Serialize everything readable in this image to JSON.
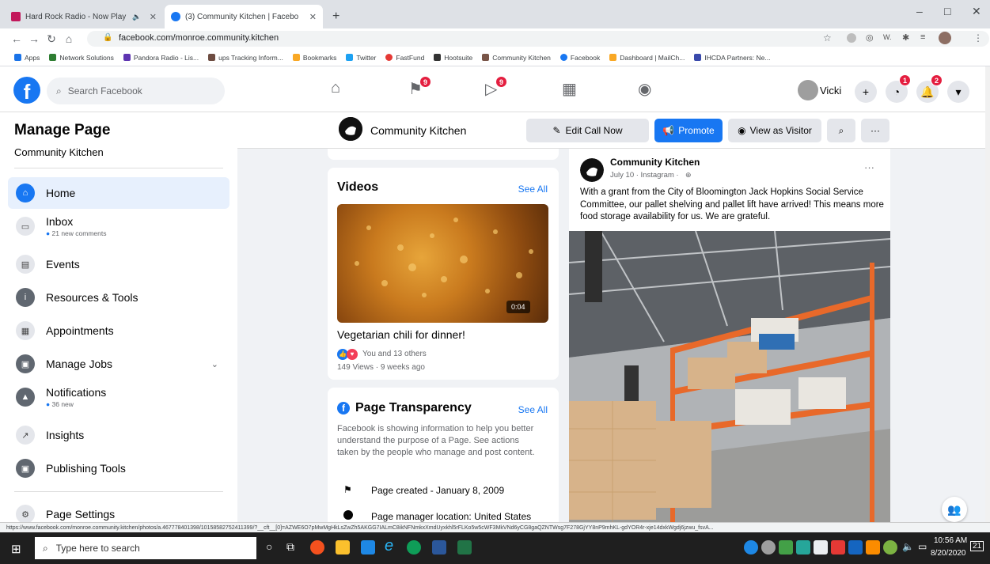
{
  "browser": {
    "tabs": [
      {
        "title": "Hard Rock Radio - Now Play",
        "favicon_color": "#c2185b"
      },
      {
        "title": "(3) Community Kitchen | Facebo",
        "favicon_color": "#1877f2"
      }
    ],
    "url": "facebook.com/monroe.community.kitchen",
    "bookmarks": [
      {
        "label": "Apps",
        "color": "#1a73e8"
      },
      {
        "label": "Network Solutions",
        "color": "#2e7d32"
      },
      {
        "label": "Pandora Radio - Lis...",
        "color": "#5e35b1"
      },
      {
        "label": "ups Tracking Inform...",
        "color": "#6d4c41"
      },
      {
        "label": "Bookmarks",
        "color": "#f9a825"
      },
      {
        "label": "Twitter",
        "color": "#1da1f2"
      },
      {
        "label": "FastFund",
        "color": "#e53935"
      },
      {
        "label": "Hootsuite",
        "color": "#333333"
      },
      {
        "label": "Community Kitchen",
        "color": "#795548"
      },
      {
        "label": "Facebook",
        "color": "#1877f2"
      },
      {
        "label": "Dashboard | MailCh...",
        "color": "#f9a825"
      },
      {
        "label": "IHCDA Partners: Ne...",
        "color": "#3949ab"
      }
    ],
    "status_url": "https://www.facebook.com/monroe.community.kitchen/photos/a.467778401398/10158582752411399/?__cft__[0]=AZWE6O7pMwMgHkLsZwZh5AKGG7IALmC8ikNFNmkxXmdUyxkhl5rFLKo5w5cWF3MkVNd6yCG8gaQZNTWsg7F278GjYY8nP9mhKL-gdYOR4r-xje14dxkWgdj6jzwu_fsvA..."
  },
  "fb": {
    "search_placeholder": "Search Facebook",
    "nav_badges": {
      "flag": "9",
      "video": "9",
      "messenger": "1",
      "notifications": "2"
    },
    "user_name": "Vicki"
  },
  "sidebar": {
    "title": "Manage Page",
    "subtitle": "Community Kitchen",
    "items": [
      {
        "label": "Home",
        "sub": ""
      },
      {
        "label": "Inbox",
        "sub": "21 new comments"
      },
      {
        "label": "Events",
        "sub": ""
      },
      {
        "label": "Resources & Tools",
        "sub": ""
      },
      {
        "label": "Appointments",
        "sub": ""
      },
      {
        "label": "Manage Jobs",
        "sub": ""
      },
      {
        "label": "Notifications",
        "sub": "36 new"
      },
      {
        "label": "Insights",
        "sub": ""
      },
      {
        "label": "Publishing Tools",
        "sub": ""
      },
      {
        "label": "Page Settings",
        "sub": ""
      }
    ]
  },
  "page_bar": {
    "page_name": "Community Kitchen",
    "edit_call": "Edit Call Now",
    "promote": "Promote",
    "view_as": "View as Visitor",
    "more": "···"
  },
  "videos": {
    "heading": "Videos",
    "see_all": "See All",
    "duration": "0:04",
    "title": "Vegetarian chili for dinner!",
    "reactions": "You and 13 others",
    "meta": "149 Views · 9 weeks ago"
  },
  "transparency": {
    "heading": "Page Transparency",
    "see_all": "See All",
    "body": "Facebook is showing information to help you better understand the purpose of a Page. See actions taken by the people who manage and post content.",
    "created": "Page created - January 8, 2009",
    "location": "Page manager location: United States"
  },
  "post": {
    "author": "Community Kitchen",
    "meta": "July 10 · Instagram ·",
    "more": "···",
    "text": "With a grant from the City of Bloomington Jack Hopkins Social Service Committee, our pallet shelving and pallet lift have arrived! This means more food storage availability for us. We are grateful."
  },
  "taskbar": {
    "search_placeholder": "Type here to search",
    "time": "10:56 AM",
    "date": "8/20/2020",
    "notif_count": "21"
  }
}
